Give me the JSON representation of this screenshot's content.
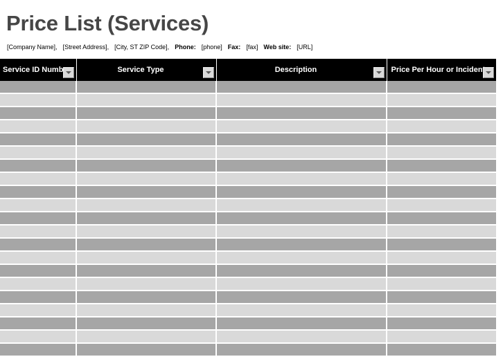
{
  "document": {
    "title": "Price List (Services)",
    "contact_line": {
      "company": "[Company Name],",
      "street": "[Street Address],",
      "citystatezip": "[City, ST  ZIP Code],",
      "phone_label": "Phone:",
      "phone_value": "[phone]",
      "fax_label": "Fax:",
      "fax_value": "[fax]",
      "web_label": "Web site:",
      "web_value": "[URL]"
    }
  },
  "table": {
    "columns": [
      {
        "label": "Service ID Number",
        "align": "center",
        "filter_icon": "chevron-down-icon"
      },
      {
        "label": "Service Type",
        "align": "center",
        "filter_icon": "chevron-down-icon"
      },
      {
        "label": "Description",
        "align": "center",
        "filter_icon": "chevron-down-icon"
      },
      {
        "label": "Price Per Hour or Incident",
        "align": "left",
        "filter_icon": "chevron-down-icon"
      }
    ],
    "row_count": 21,
    "rows": [
      [
        "",
        "",
        "",
        ""
      ],
      [
        "",
        "",
        "",
        ""
      ],
      [
        "",
        "",
        "",
        ""
      ],
      [
        "",
        "",
        "",
        ""
      ],
      [
        "",
        "",
        "",
        ""
      ],
      [
        "",
        "",
        "",
        ""
      ],
      [
        "",
        "",
        "",
        ""
      ],
      [
        "",
        "",
        "",
        ""
      ],
      [
        "",
        "",
        "",
        ""
      ],
      [
        "",
        "",
        "",
        ""
      ],
      [
        "",
        "",
        "",
        ""
      ],
      [
        "",
        "",
        "",
        ""
      ],
      [
        "",
        "",
        "",
        ""
      ],
      [
        "",
        "",
        "",
        ""
      ],
      [
        "",
        "",
        "",
        ""
      ],
      [
        "",
        "",
        "",
        ""
      ],
      [
        "",
        "",
        "",
        ""
      ],
      [
        "",
        "",
        "",
        ""
      ],
      [
        "",
        "",
        "",
        ""
      ],
      [
        "",
        "",
        "",
        ""
      ],
      [
        "",
        "",
        "",
        ""
      ]
    ]
  },
  "colors": {
    "title": "#464646",
    "header_bg": "#000000",
    "header_text": "#ffffff",
    "row_dark": "#a6a6a6",
    "row_light": "#d9d9d9",
    "page_bg": "#ffffff",
    "filter_button": "#d9d9d9"
  }
}
